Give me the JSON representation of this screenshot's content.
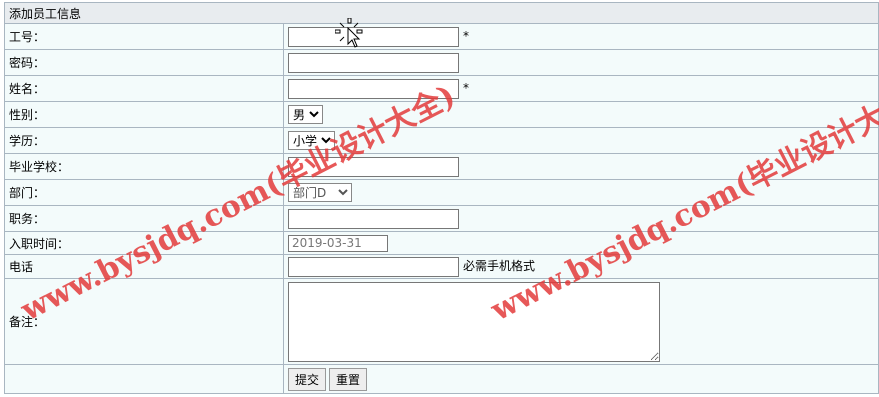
{
  "form": {
    "title": "添加员工信息",
    "fields": {
      "employee_id": {
        "label": "工号：",
        "value": "",
        "required_mark": "*"
      },
      "password": {
        "label": "密码：",
        "value": ""
      },
      "name": {
        "label": "姓名：",
        "value": "",
        "required_mark": "*"
      },
      "gender": {
        "label": "性别：",
        "selected": "男"
      },
      "education": {
        "label": "学历：",
        "selected": "小学"
      },
      "school": {
        "label": "毕业学校：",
        "value": ""
      },
      "department": {
        "label": "部门：",
        "selected": "部门D"
      },
      "position": {
        "label": "职务：",
        "value": ""
      },
      "hire_date": {
        "label": "入职时间：",
        "value": "2019-03-31"
      },
      "phone": {
        "label": "电话",
        "value": "",
        "hint": "必需手机格式"
      },
      "remarks": {
        "label": "备注：",
        "value": ""
      }
    },
    "buttons": {
      "submit": "提交",
      "reset": "重置"
    }
  },
  "watermark_text": "www.bysjdq.com(毕业设计大全)",
  "colors": {
    "watermark": "#e33b3b",
    "table_bg": "#f3fbfb",
    "border": "#a9b6c1"
  }
}
